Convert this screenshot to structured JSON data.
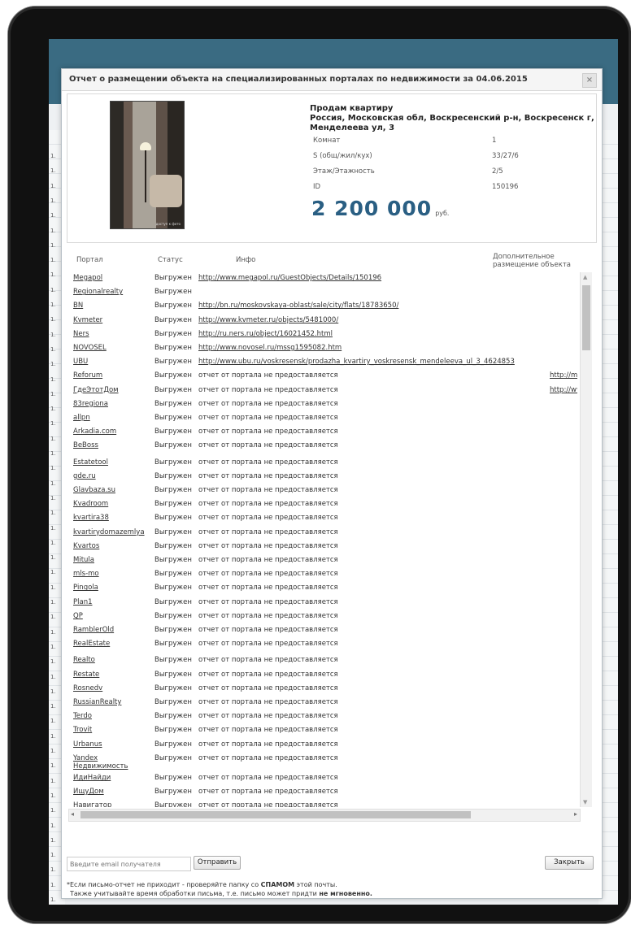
{
  "dialog": {
    "title": "Отчет о размещении объекта на специализированных порталах по недвижимости за 04.06.2015",
    "close_glyph": "×"
  },
  "property": {
    "heading": "Продам квартиру",
    "address": "Россия, Московская обл, Воскресенский р-н, Воскресенск г, Менделеева ул, 3",
    "photo_caption": "доступ к фото",
    "specs": [
      {
        "label": "Комнат",
        "value": "1"
      },
      {
        "label": "S (общ/жил/кух)",
        "value": "33/27/6"
      },
      {
        "label": "Этаж/Этажность",
        "value": "2/5"
      },
      {
        "label": "ID",
        "value": "150196"
      }
    ],
    "price": "2 200 000",
    "currency": "руб."
  },
  "table": {
    "columns": {
      "portal": "Портал",
      "status": "Статус",
      "info": "Инфо",
      "extra": "Дополнительное размещение объекта"
    },
    "rows": [
      {
        "portal": "Megapol",
        "status": "Выгружен",
        "info": "http://www.megapol.ru/GuestObjects/Details/150196",
        "link": true,
        "extra": ""
      },
      {
        "portal": "Regionalrealty",
        "status": "Выгружен",
        "info": "",
        "link": false,
        "extra": ""
      },
      {
        "portal": "BN",
        "status": "Выгружен",
        "info": "http://bn.ru/moskovskaya-oblast/sale/city/flats/18783650/",
        "link": true,
        "extra": ""
      },
      {
        "portal": "Kvmeter",
        "status": "Выгружен",
        "info": "http://www.kvmeter.ru/objects/5481000/",
        "link": true,
        "extra": ""
      },
      {
        "portal": "Ners",
        "status": "Выгружен",
        "info": "http://ru.ners.ru/object/16021452.html",
        "link": true,
        "extra": ""
      },
      {
        "portal": "NOVOSEL",
        "status": "Выгружен",
        "info": "http://www.novosel.ru/mssg1595082.htm",
        "link": true,
        "extra": ""
      },
      {
        "portal": "UBU",
        "status": "Выгружен",
        "info": "http://www.ubu.ru/voskresensk/prodazha_kvartiry_voskresensk_mendeleeva_ul_3_4624853",
        "link": true,
        "extra": ""
      },
      {
        "portal": "Reforum",
        "status": "Выгружен",
        "info": "отчет от портала не предоставляется",
        "link": false,
        "extra": "http://ms"
      },
      {
        "portal": "ГдеЭтотДом",
        "status": "Выгружен",
        "info": "отчет от портала не предоставляется",
        "link": false,
        "extra": "http://ww"
      },
      {
        "portal": "83regiona",
        "status": "Выгружен",
        "info": "отчет от портала не предоставляется",
        "link": false,
        "extra": ""
      },
      {
        "portal": "allpn",
        "status": "Выгружен",
        "info": "отчет от портала не предоставляется",
        "link": false,
        "extra": ""
      },
      {
        "portal": "Arkadia.com",
        "status": "Выгружен",
        "info": "отчет от портала не предоставляется",
        "link": false,
        "extra": ""
      },
      {
        "portal": "BeBoss",
        "status": "Выгружен",
        "info": "отчет от портала не предоставляется",
        "link": false,
        "extra": ""
      },
      {
        "portal": "Estatetool",
        "status": "Выгружен",
        "info": "отчет от портала не предоставляется",
        "link": false,
        "extra": ""
      },
      {
        "portal": "gde.ru",
        "status": "Выгружен",
        "info": "отчет от портала не предоставляется",
        "link": false,
        "extra": ""
      },
      {
        "portal": "Glavbaza.su",
        "status": "Выгружен",
        "info": "отчет от портала не предоставляется",
        "link": false,
        "extra": ""
      },
      {
        "portal": "Kvadroom",
        "status": "Выгружен",
        "info": "отчет от портала не предоставляется",
        "link": false,
        "extra": ""
      },
      {
        "portal": "kvartira38",
        "status": "Выгружен",
        "info": "отчет от портала не предоставляется",
        "link": false,
        "extra": ""
      },
      {
        "portal": "kvartirydomazemlya",
        "status": "Выгружен",
        "info": "отчет от портала не предоставляется",
        "link": false,
        "extra": ""
      },
      {
        "portal": "Kvartos",
        "status": "Выгружен",
        "info": "отчет от портала не предоставляется",
        "link": false,
        "extra": ""
      },
      {
        "portal": "Mitula",
        "status": "Выгружен",
        "info": "отчет от портала не предоставляется",
        "link": false,
        "extra": ""
      },
      {
        "portal": "mls-mo",
        "status": "Выгружен",
        "info": "отчет от портала не предоставляется",
        "link": false,
        "extra": ""
      },
      {
        "portal": "Pingola",
        "status": "Выгружен",
        "info": "отчет от портала не предоставляется",
        "link": false,
        "extra": ""
      },
      {
        "portal": "Plan1",
        "status": "Выгружен",
        "info": "отчет от портала не предоставляется",
        "link": false,
        "extra": ""
      },
      {
        "portal": "QP",
        "status": "Выгружен",
        "info": "отчет от портала не предоставляется",
        "link": false,
        "extra": ""
      },
      {
        "portal": "RamblerOld",
        "status": "Выгружен",
        "info": "отчет от портала не предоставляется",
        "link": false,
        "extra": ""
      },
      {
        "portal": "RealEstate",
        "status": "Выгружен",
        "info": "отчет от портала не предоставляется",
        "link": false,
        "extra": ""
      },
      {
        "portal": "Realto",
        "status": "Выгружен",
        "info": "отчет от портала не предоставляется",
        "link": false,
        "extra": ""
      },
      {
        "portal": "Restate",
        "status": "Выгружен",
        "info": "отчет от портала не предоставляется",
        "link": false,
        "extra": ""
      },
      {
        "portal": "Rosnedv",
        "status": "Выгружен",
        "info": "отчет от портала не предоставляется",
        "link": false,
        "extra": ""
      },
      {
        "portal": "RussianRealty",
        "status": "Выгружен",
        "info": "отчет от портала не предоставляется",
        "link": false,
        "extra": ""
      },
      {
        "portal": "Terdo",
        "status": "Выгружен",
        "info": "отчет от портала не предоставляется",
        "link": false,
        "extra": ""
      },
      {
        "portal": "Trovit",
        "status": "Выгружен",
        "info": "отчет от портала не предоставляется",
        "link": false,
        "extra": ""
      },
      {
        "portal": "Urbanus",
        "status": "Выгружен",
        "info": "отчет от портала не предоставляется",
        "link": false,
        "extra": ""
      },
      {
        "portal": "Yandex Недвижимость",
        "status": "Выгружен",
        "info": "отчет от портала не предоставляется",
        "link": false,
        "extra": ""
      },
      {
        "portal": "ИдиНайди",
        "status": "Выгружен",
        "info": "отчет от портала не предоставляется",
        "link": false,
        "extra": ""
      },
      {
        "portal": "ИщуДом",
        "status": "Выгружен",
        "info": "отчет от портала не предоставляется",
        "link": false,
        "extra": ""
      },
      {
        "portal": "Навигатор",
        "status": "Выгружен",
        "info": "отчет от портала не предоставляется",
        "link": false,
        "extra": ""
      }
    ]
  },
  "footer": {
    "email_placeholder": "Введите email получателя",
    "send_label": "Отправить",
    "close_label": "Закрыть",
    "note_line1_pre": "*Если письмо-отчет не приходит - проверяйте папку со ",
    "note_line1_bold": "СПАМОМ",
    "note_line1_post": " этой почты.",
    "note_line2_pre": "Также учитывайте время обработки письма, т.е. письмо может придти ",
    "note_line2_bold": "не мгновенно."
  },
  "background_app": {
    "row_label": "1.",
    "header_color": "#3a6b82"
  }
}
